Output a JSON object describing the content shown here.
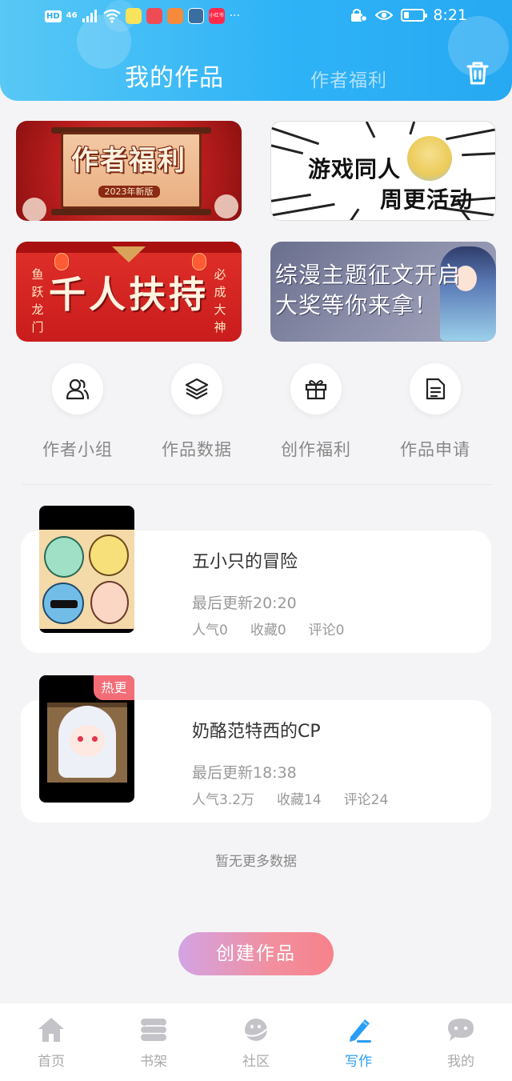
{
  "status_bar": {
    "hd": "HD",
    "signal": "46",
    "app_badge": "小红书",
    "dots": "···",
    "time": "8:21"
  },
  "header": {
    "tab_mine": "我的作品",
    "tab_welfare": "作者福利",
    "trash_icon": "trash-icon"
  },
  "banners": [
    {
      "title": "作者福利",
      "subtitle": "2023年新版"
    },
    {
      "line1": "游戏同人",
      "line2": "周更活动"
    },
    {
      "title": "千人扶持",
      "left_vertical": "鱼跃龙门",
      "right_vertical": "必成大神"
    },
    {
      "line1": "综漫主题征文开启",
      "line2": "大奖等你来拿！"
    }
  ],
  "quick_actions": [
    {
      "label": "作者小组",
      "icon": "users-icon"
    },
    {
      "label": "作品数据",
      "icon": "layers-icon"
    },
    {
      "label": "创作福利",
      "icon": "gift-icon"
    },
    {
      "label": "作品申请",
      "icon": "document-icon"
    }
  ],
  "works": [
    {
      "title": "五小只的冒险",
      "updated": "最后更新20:20",
      "popularity": "人气0",
      "favorites": "收藏0",
      "comments": "评论0"
    },
    {
      "title": "奶酪范特西的CP",
      "tag": "热更",
      "updated": "最后更新18:38",
      "popularity": "人气3.2万",
      "favorites": "收藏14",
      "comments": "评论24"
    }
  ],
  "no_more": "暂无更多数据",
  "create_button": "创建作品",
  "bottom_nav": [
    {
      "label": "首页",
      "icon": "home-icon",
      "active": false
    },
    {
      "label": "书架",
      "icon": "bookshelf-icon",
      "active": false
    },
    {
      "label": "社区",
      "icon": "planet-icon",
      "active": false
    },
    {
      "label": "写作",
      "icon": "pen-icon",
      "active": true
    },
    {
      "label": "我的",
      "icon": "chat-bubble-icon",
      "active": false
    }
  ],
  "colors": {
    "header_blue": "#2fb3f7",
    "active_nav": "#2a9df4",
    "hot_tag": "#f36d77",
    "create_gradient_start": "#d3a3e4",
    "create_gradient_end": "#f7828b"
  }
}
